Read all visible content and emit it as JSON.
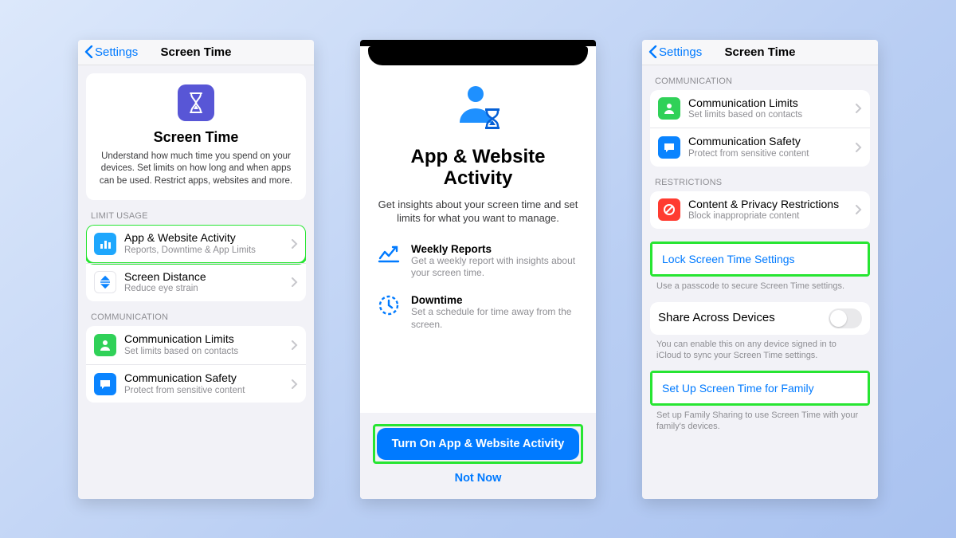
{
  "nav": {
    "back": "Settings",
    "title": "Screen Time"
  },
  "phone1": {
    "hero_title": "Screen Time",
    "hero_desc": "Understand how much time you spend on your devices. Set limits on how long and when apps can be used. Restrict apps, websites and more.",
    "sec_limit": "LIMIT USAGE",
    "row_activity_title": "App & Website Activity",
    "row_activity_sub": "Reports, Downtime & App Limits",
    "row_distance_title": "Screen Distance",
    "row_distance_sub": "Reduce eye strain",
    "sec_comm": "COMMUNICATION",
    "row_commlim_title": "Communication Limits",
    "row_commlim_sub": "Set limits based on contacts",
    "row_commsafe_title": "Communication Safety",
    "row_commsafe_sub": "Protect from sensitive content"
  },
  "phone2": {
    "title": "App & Website Activity",
    "sub": "Get insights about your screen time and set limits for what you want to manage.",
    "feat1_title": "Weekly Reports",
    "feat1_sub": "Get a weekly report with insights about your screen time.",
    "feat2_title": "Downtime",
    "feat2_sub": "Set a schedule for time away from the screen.",
    "primary": "Turn On App & Website Activity",
    "secondary": "Not Now"
  },
  "phone3": {
    "sec_comm": "COMMUNICATION",
    "row_commlim_title": "Communication Limits",
    "row_commlim_sub": "Set limits based on contacts",
    "row_commsafe_title": "Communication Safety",
    "row_commsafe_sub": "Protect from sensitive content",
    "sec_restr": "RESTRICTIONS",
    "row_restrict_title": "Content & Privacy Restrictions",
    "row_restrict_sub": "Block inappropriate content",
    "link_lock": "Lock Screen Time Settings",
    "lock_note": "Use a passcode to secure Screen Time settings.",
    "row_share_title": "Share Across Devices",
    "share_note": "You can enable this on any device signed in to iCloud to sync your Screen Time settings.",
    "link_family": "Set Up Screen Time for Family",
    "family_note": "Set up Family Sharing to use Screen Time with your family's devices."
  }
}
